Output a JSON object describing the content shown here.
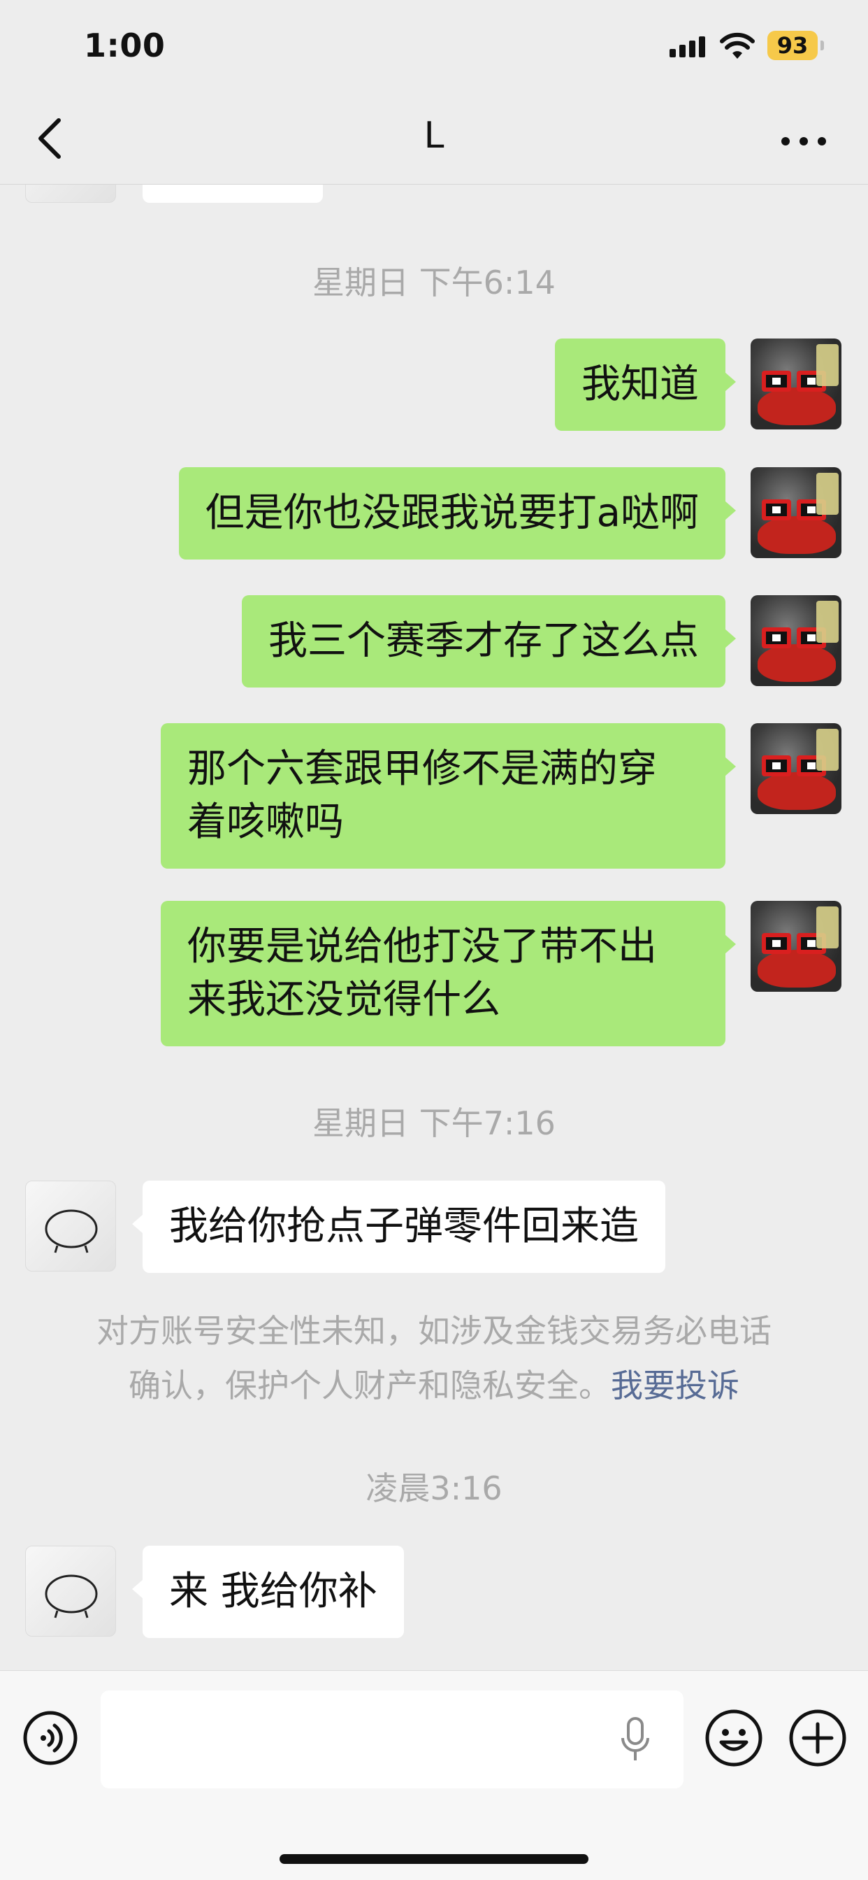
{
  "status_bar": {
    "time": "1:00",
    "battery": "93",
    "battery_color": "#f6c94a"
  },
  "nav": {
    "title": "L",
    "back_icon": "chevron-left-icon",
    "more_icon": "more-icon"
  },
  "chat": {
    "timestamps": [
      "星期日 下午6:14",
      "星期日 下午7:16",
      "凌晨3:16"
    ],
    "messages": [
      {
        "from": "self",
        "text": "我知道"
      },
      {
        "from": "self",
        "text": "但是你也没跟我说要打a哒啊"
      },
      {
        "from": "self",
        "text": "我三个赛季才存了这么点"
      },
      {
        "from": "self",
        "text": "那个六套跟甲修不是满的穿\n着咳嗽吗"
      },
      {
        "from": "self",
        "text": "你要是说给他打没了带不出\n来我还没觉得什么"
      },
      {
        "from": "other",
        "text": "我给你抢点子弹零件回来造"
      },
      {
        "from": "other",
        "text": "来 我给你补"
      }
    ],
    "notice": {
      "line1": "对方账号安全性未知，如涉及金钱交易务必电话",
      "line2": "确认，保护个人财产和隐私安全。",
      "link": "我要投诉"
    },
    "colors": {
      "self_bubble": "#a9e97a",
      "other_bubble": "#ffffff",
      "link": "#576b95"
    }
  },
  "input_bar": {
    "text_value": "",
    "icons": [
      "voice-icon",
      "mic-icon",
      "emoji-icon",
      "plus-icon"
    ]
  }
}
